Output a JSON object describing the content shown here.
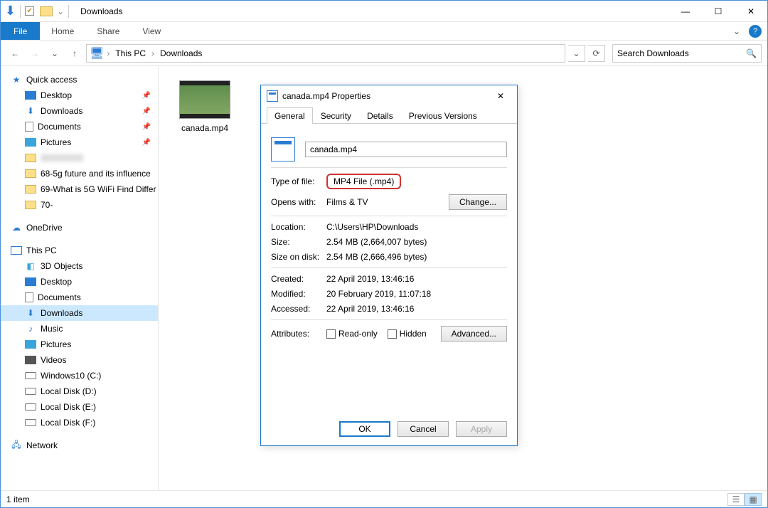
{
  "window": {
    "title": "Downloads",
    "minimize": "—",
    "maximize": "☐",
    "close": "✕"
  },
  "ribbon": {
    "file": "File",
    "tabs": [
      "Home",
      "Share",
      "View"
    ],
    "collapse": "⌄",
    "help": "?"
  },
  "nav": {
    "back": "←",
    "forward": "→",
    "recent": "⌄",
    "up": "↑",
    "breadcrumb": [
      "This PC",
      "Downloads"
    ],
    "refresh": "⟳",
    "dropdown": "⌄",
    "search_placeholder": "Search Downloads",
    "mag": "🔍"
  },
  "navpane": {
    "quick": {
      "label": "Quick access",
      "items": [
        {
          "icon": "desktop",
          "label": "Desktop",
          "pin": true
        },
        {
          "icon": "downloads",
          "label": "Downloads",
          "pin": true
        },
        {
          "icon": "documents",
          "label": "Documents",
          "pin": true
        },
        {
          "icon": "pictures",
          "label": "Pictures",
          "pin": true
        },
        {
          "icon": "folder",
          "label": "",
          "pin": false
        },
        {
          "icon": "folder",
          "label": "68-5g future and its influence",
          "pin": false
        },
        {
          "icon": "folder",
          "label": "69-What is 5G WiFi Find Differ",
          "pin": false
        },
        {
          "icon": "folder",
          "label": "70-",
          "pin": false
        }
      ]
    },
    "onedrive": {
      "label": "OneDrive"
    },
    "thispc": {
      "label": "This PC",
      "items": [
        {
          "icon": "3d",
          "label": "3D Objects"
        },
        {
          "icon": "desktop",
          "label": "Desktop"
        },
        {
          "icon": "documents",
          "label": "Documents"
        },
        {
          "icon": "downloads",
          "label": "Downloads",
          "selected": true
        },
        {
          "icon": "music",
          "label": "Music"
        },
        {
          "icon": "pictures",
          "label": "Pictures"
        },
        {
          "icon": "videos",
          "label": "Videos"
        },
        {
          "icon": "drive",
          "label": "Windows10 (C:)"
        },
        {
          "icon": "drive",
          "label": "Local Disk (D:)"
        },
        {
          "icon": "drive",
          "label": "Local Disk (E:)"
        },
        {
          "icon": "drive",
          "label": "Local Disk (F:)"
        }
      ]
    },
    "network": {
      "label": "Network"
    }
  },
  "content": {
    "file_label": "canada.mp4"
  },
  "status": {
    "text": "1 item"
  },
  "dialog": {
    "title": "canada.mp4 Properties",
    "close": "✕",
    "tabs": [
      "General",
      "Security",
      "Details",
      "Previous Versions"
    ],
    "file_name": "canada.mp4",
    "rows": {
      "type_label": "Type of file:",
      "type_value": "MP4 File (.mp4)",
      "opens_label": "Opens with:",
      "opens_value": "Films & TV",
      "change": "Change...",
      "location_label": "Location:",
      "location_value": "C:\\Users\\HP\\Downloads",
      "size_label": "Size:",
      "size_value": "2.54 MB (2,664,007 bytes)",
      "sod_label": "Size on disk:",
      "sod_value": "2.54 MB (2,666,496 bytes)",
      "created_label": "Created:",
      "created_value": "22 April 2019, 13:46:16",
      "modified_label": "Modified:",
      "modified_value": "20 February 2019, 11:07:18",
      "accessed_label": "Accessed:",
      "accessed_value": "22 April 2019, 13:46:16",
      "attr_label": "Attributes:",
      "readonly": "Read-only",
      "hidden": "Hidden",
      "advanced": "Advanced..."
    },
    "actions": {
      "ok": "OK",
      "cancel": "Cancel",
      "apply": "Apply"
    }
  }
}
